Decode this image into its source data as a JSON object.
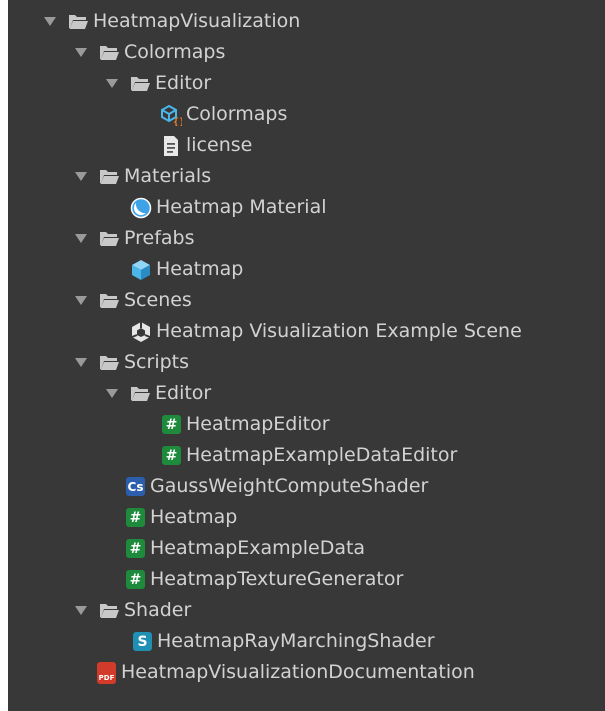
{
  "colors": {
    "background": "#383838",
    "text": "#d2d2d2",
    "arrow": "#9a9a9a",
    "folder": "#c8c8c8",
    "script_badge": "#1e8a3c",
    "cs_badge": "#2b5fae",
    "shader_badge": "#1f8fb3",
    "pdf_badge": "#d23a2a",
    "prefab": "#4bb6ea",
    "material": "#3da2e6"
  },
  "tree": {
    "root": {
      "label": "HeatmapVisualization",
      "icon": "folder-open-icon"
    },
    "colormaps": {
      "label": "Colormaps",
      "icon": "folder-open-icon"
    },
    "colormaps_editor": {
      "label": "Editor",
      "icon": "folder-open-icon"
    },
    "colormaps_asset": {
      "label": "Colormaps",
      "icon": "scriptable-object-icon"
    },
    "license": {
      "label": "license",
      "icon": "text-file-icon"
    },
    "materials": {
      "label": "Materials",
      "icon": "folder-open-icon"
    },
    "heatmap_material": {
      "label": "Heatmap Material",
      "icon": "material-icon"
    },
    "prefabs": {
      "label": "Prefabs",
      "icon": "folder-open-icon"
    },
    "heatmap_prefab": {
      "label": "Heatmap",
      "icon": "prefab-icon"
    },
    "scenes": {
      "label": "Scenes",
      "icon": "folder-open-icon"
    },
    "example_scene": {
      "label": "Heatmap Visualization Example Scene",
      "icon": "unity-scene-icon"
    },
    "scripts": {
      "label": "Scripts",
      "icon": "folder-open-icon"
    },
    "scripts_editor": {
      "label": "Editor",
      "icon": "folder-open-icon"
    },
    "heatmap_editor": {
      "label": "HeatmapEditor",
      "icon": "csharp-script-icon",
      "badge": "#"
    },
    "example_data_editor": {
      "label": "HeatmapExampleDataEditor",
      "icon": "csharp-script-icon",
      "badge": "#"
    },
    "gauss_compute": {
      "label": "GaussWeightComputeShader",
      "icon": "compute-shader-icon",
      "badge": "Cs"
    },
    "heatmap_script": {
      "label": "Heatmap",
      "icon": "csharp-script-icon",
      "badge": "#"
    },
    "example_data": {
      "label": "HeatmapExampleData",
      "icon": "csharp-script-icon",
      "badge": "#"
    },
    "texture_generator": {
      "label": "HeatmapTextureGenerator",
      "icon": "csharp-script-icon",
      "badge": "#"
    },
    "shader": {
      "label": "Shader",
      "icon": "folder-open-icon"
    },
    "raymarching_shader": {
      "label": "HeatmapRayMarchingShader",
      "icon": "shader-icon",
      "badge": "S"
    },
    "documentation": {
      "label": "HeatmapVisualizationDocumentation",
      "icon": "pdf-icon",
      "badge": "PDF"
    }
  }
}
